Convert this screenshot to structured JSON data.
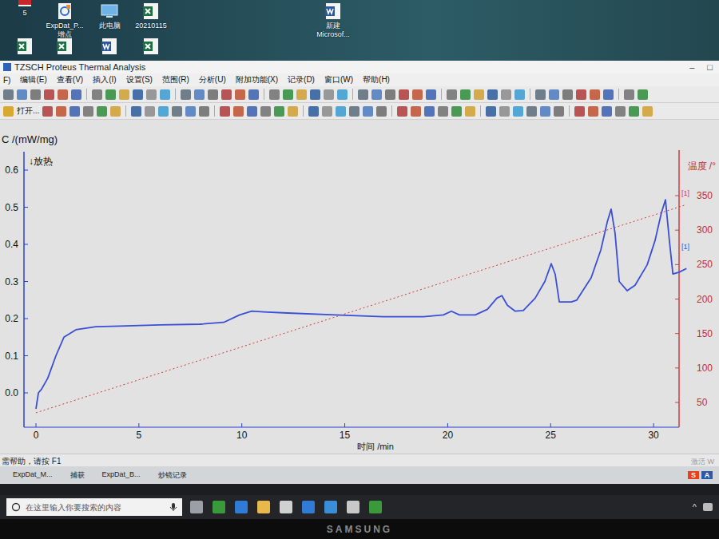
{
  "desktop": {
    "icons": [
      {
        "kind": "pdf",
        "lines": [
          "5"
        ]
      },
      {
        "kind": "origin",
        "lines": [
          "ExpDat_P...",
          "增点"
        ]
      },
      {
        "kind": "pc",
        "lines": [
          "此电脑"
        ]
      },
      {
        "kind": "excel",
        "lines": [
          "20210115"
        ]
      },
      {
        "kind": "word",
        "lines": [
          "新建",
          "Microsof..."
        ]
      },
      {
        "kind": "excel",
        "lines": []
      },
      {
        "kind": "excel",
        "lines": []
      },
      {
        "kind": "word",
        "lines": []
      },
      {
        "kind": "excel",
        "lines": []
      }
    ]
  },
  "window": {
    "title": "TZSCH Proteus Thermal Analysis",
    "controls": [
      "–",
      "□"
    ]
  },
  "menu": [
    "F)",
    "编辑(E)",
    "查看(V)",
    "插入(I)",
    "设置(S)",
    "范围(R)",
    "分析(U)",
    "附加功能(X)",
    "记录(D)",
    "窗口(W)",
    "帮助(H)"
  ],
  "toolbar": {
    "open_label": "打开..."
  },
  "chart": {
    "y_title": "C /(mW/mg)",
    "exo_label": "↓放热",
    "y2_title": "温度 /°",
    "x_title": "时间 /min",
    "y_ticks": [
      "0.6",
      "0.5",
      "0.4",
      "0.3",
      "0.2",
      "0.1",
      "0.0"
    ],
    "y2_ticks": [
      "350",
      "300",
      "250",
      "200",
      "150",
      "100",
      "50"
    ],
    "x_ticks": [
      "0",
      "5",
      "10",
      "15",
      "20",
      "25",
      "30"
    ],
    "series": [
      {
        "kind": "solid",
        "color": "#3a4ed6",
        "marker": "[1]",
        "times": [
          0,
          0.12,
          0.27,
          0.58,
          0.97,
          1.36,
          1.94,
          2.91,
          4.07,
          6.01,
          7.96,
          9.12,
          9.89,
          10.48,
          11.06,
          12.22,
          14.55,
          16.88,
          18.82,
          19.79,
          20.18,
          20.57,
          21.34,
          21.93,
          22.39,
          22.63,
          22.9,
          23.28,
          23.67,
          24.25,
          24.72,
          25.03,
          25.22,
          25.42,
          26.0,
          26.27,
          26.97,
          27.44,
          27.75,
          27.94,
          28.13,
          28.33,
          28.72,
          29.1,
          29.69,
          30.07,
          30.38,
          30.58,
          30.77,
          30.94,
          31.24,
          31.6
        ],
        "values": [
          -0.043,
          0.0,
          0.01,
          0.04,
          0.1,
          0.15,
          0.17,
          0.178,
          0.18,
          0.183,
          0.185,
          0.19,
          0.21,
          0.22,
          0.218,
          0.215,
          0.21,
          0.205,
          0.205,
          0.21,
          0.22,
          0.21,
          0.21,
          0.225,
          0.255,
          0.262,
          0.236,
          0.22,
          0.222,
          0.255,
          0.3,
          0.348,
          0.32,
          0.245,
          0.245,
          0.25,
          0.31,
          0.385,
          0.46,
          0.495,
          0.43,
          0.3,
          0.275,
          0.29,
          0.345,
          0.41,
          0.485,
          0.52,
          0.41,
          0.32,
          0.325,
          0.335
        ]
      },
      {
        "kind": "dotted",
        "color": "#d23a3a",
        "marker": "[1]",
        "times": [
          0,
          31.6
        ],
        "values": [
          35,
          337
        ]
      }
    ]
  },
  "status_bar": {
    "text": "需帮助，请按 F1",
    "watermark": "激活 W"
  },
  "open_windows": [
    "ExpDat_M...",
    "捕获",
    "ExpDat_B...",
    "炒镜记录"
  ],
  "ime": [
    "S",
    "A"
  ],
  "taskbar": {
    "search": {
      "placeholder": "在这里输入你要搜索的内容"
    },
    "tray": [
      "^"
    ]
  },
  "monitor": {
    "brand": "SAMSUNG"
  }
}
